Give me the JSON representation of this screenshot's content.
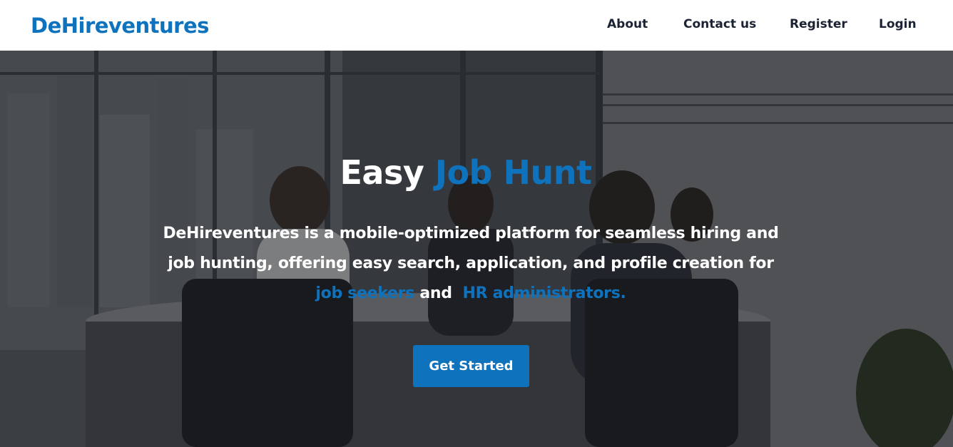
{
  "brand": {
    "name": "DeHireventures"
  },
  "nav": {
    "items": [
      {
        "label": "About"
      },
      {
        "label": "Contact us"
      },
      {
        "label": "Register"
      },
      {
        "label": "Login"
      }
    ]
  },
  "hero": {
    "title_plain": "Easy",
    "title_accent": "Job Hunt",
    "description_line1": "DeHireventures is a mobile-optimized platform for seamless hiring and",
    "description_line2": "job hunting, offering easy search, application, and profile creation for",
    "highlight_1": "job seekers",
    "joiner": "and",
    "highlight_2": "HR administrators.",
    "cta_label": "Get Started",
    "background_image": "office-meeting-photo"
  },
  "colors": {
    "accent": "#0f72bd",
    "nav_text": "#1a2233",
    "hero_text": "#ffffff"
  }
}
